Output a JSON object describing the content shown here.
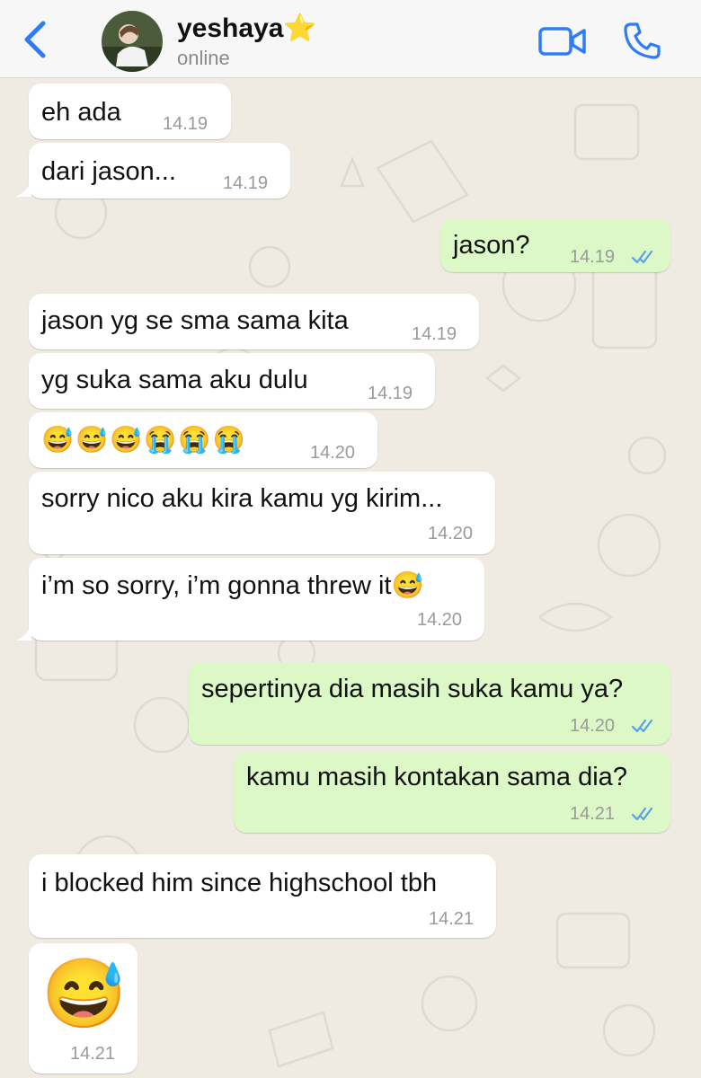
{
  "header": {
    "contact_name": "yeshaya⭐",
    "status": "online"
  },
  "messages": [
    {
      "dir": "in",
      "text": "eh ada",
      "time": "14.19"
    },
    {
      "dir": "in",
      "text": "dari jason...",
      "time": "14.19"
    },
    {
      "dir": "out",
      "text": "jason?",
      "time": "14.19"
    },
    {
      "dir": "in",
      "text": "jason yg se sma sama kita",
      "time": "14.19"
    },
    {
      "dir": "in",
      "text": "yg suka sama aku dulu",
      "time": "14.19"
    },
    {
      "dir": "in",
      "text": "😅😅😅😭😭😭",
      "time": "14.20"
    },
    {
      "dir": "in",
      "text": "sorry nico aku kira kamu yg kirim...",
      "time": "14.20"
    },
    {
      "dir": "in",
      "text": "i’m so sorry, i’m gonna threw it😅",
      "time": "14.20"
    },
    {
      "dir": "out",
      "text": "sepertinya dia masih suka kamu ya?",
      "time": "14.20"
    },
    {
      "dir": "out",
      "text": "kamu masih kontakan sama dia?",
      "time": "14.21"
    },
    {
      "dir": "in",
      "text": "i blocked him since highschool tbh",
      "time": "14.21"
    },
    {
      "dir": "in",
      "text": "😅",
      "time": "14.21"
    }
  ],
  "colors": {
    "accent": "#2f7cf6",
    "incoming_bubble": "#ffffff",
    "outgoing_bubble": "#dcf8c6",
    "read_ticks": "#5aa0e8",
    "wallpaper": "#efeae2"
  },
  "icons": [
    "back-chevron-icon",
    "avatar",
    "video-call-icon",
    "phone-icon",
    "double-check-icon"
  ]
}
